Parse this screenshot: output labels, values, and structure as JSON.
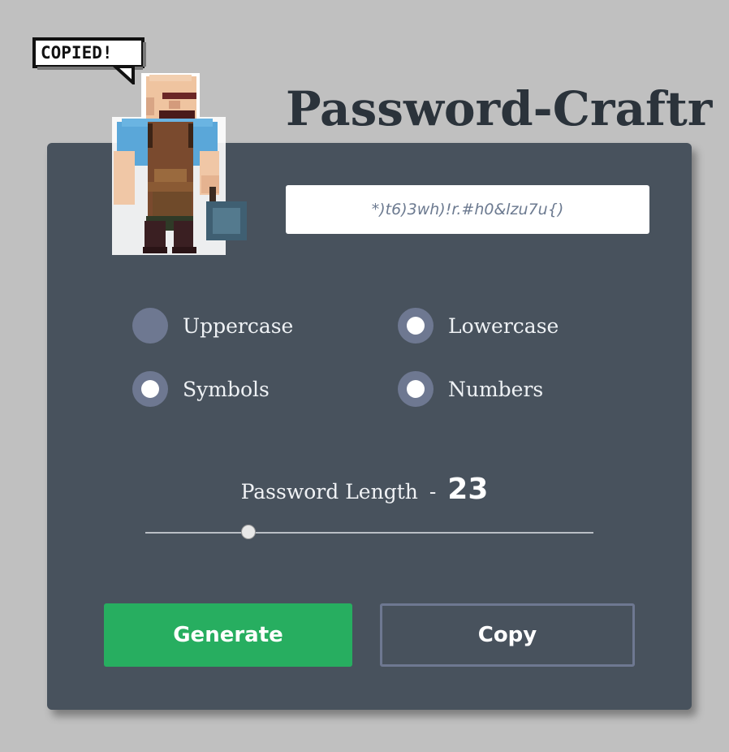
{
  "app": {
    "title": "Password-Craftr"
  },
  "toast": {
    "text": "COPIED!"
  },
  "mascot": {
    "icon": "blacksmith-character-icon"
  },
  "password": {
    "value": "*)t6)3wh)!r.#h0&lzu7u{)"
  },
  "options": [
    {
      "label": "Uppercase",
      "checked": false
    },
    {
      "label": "Lowercase",
      "checked": true
    },
    {
      "label": "Symbols",
      "checked": true
    },
    {
      "label": "Numbers",
      "checked": true
    }
  ],
  "length": {
    "label": "Password Length",
    "separator": "-",
    "value": "23",
    "fill_fraction": 0.23
  },
  "buttons": {
    "generate": "Generate",
    "copy": "Copy"
  },
  "colors": {
    "background": "#c0c0c0",
    "card": "#48525d",
    "title": "#2b333b",
    "accent_green": "#27ae60",
    "radio": "#6e7891"
  }
}
